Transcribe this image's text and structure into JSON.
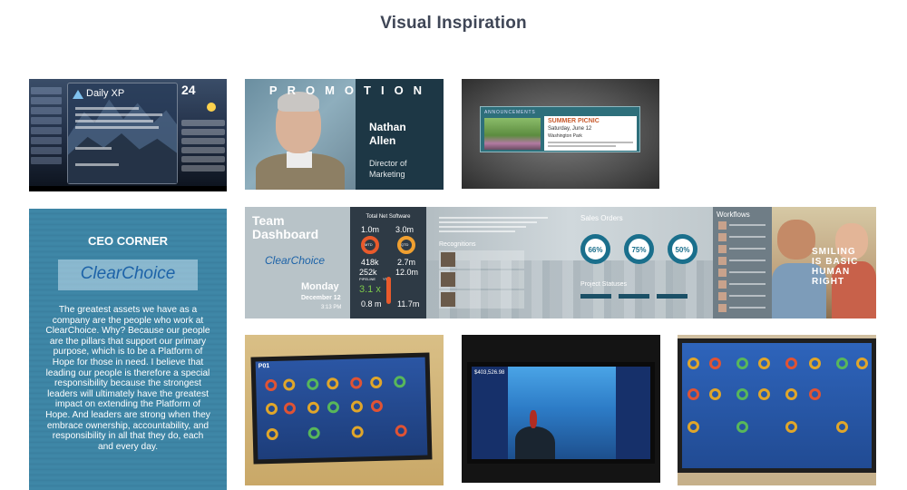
{
  "page": {
    "section_title": "Visual Inspiration"
  },
  "tiles": {
    "daily_xp": {
      "title": "Daily XP",
      "date_number": "24"
    },
    "promotion": {
      "heading": "PROMOTION",
      "first_name": "Nathan",
      "last_name": "Allen",
      "role_line1": "Director of",
      "role_line2": "Marketing"
    },
    "announcements": {
      "label": "ANNOUNCEMENTS",
      "event": "SUMMER PICNIC",
      "date": "Saturday, June 12",
      "location": "Washington Park"
    },
    "ceo_corner": {
      "heading": "CEO CORNER",
      "logo": "ClearChoice",
      "quote": "The greatest assets we have as a company are the people who work at ClearChoice. Why? Because our people are the pillars that support our primary purpose, which is to be a Platform of Hope for those in need. I believe that leading our people is therefore a special responsibility because the strongest leaders will ultimately have the greatest impact on extending the Platform of Hope. And leaders are strong when they embrace ownership, accountability, and responsibility in all that they do, each and every day."
    },
    "team_dashboard": {
      "title_line1": "Team",
      "title_line2": "Dashboard",
      "logo": "ClearChoice",
      "day": "Monday",
      "date": "December 12",
      "time": "3:13 PM",
      "metrics_heading": "Total Net Software",
      "metrics": {
        "v1": "1.0m",
        "v2": "3.0m",
        "mtd": "MTD",
        "qtd": "QTD",
        "v3": "418k",
        "v4": "2.7m",
        "v5": "252k",
        "v6": "12.0m",
        "pipeline": "PIPELINE",
        "ytd": "YTD",
        "v7": "3.1 x",
        "v8": "0.8 m",
        "v9": "11.7m"
      },
      "recognitions": "Recognitions",
      "sales_orders": "Sales Orders",
      "dials": [
        "66%",
        "75%",
        "50%"
      ],
      "project_statuses": "Project Statuses",
      "workflows": "Workflows",
      "photo_caption": "SMILING IS BASIC HUMAN RIGHT"
    },
    "photo_tv_1": {
      "corner_label": "P01"
    },
    "photo_tv_2": {
      "corner_value": "$403,526.98"
    }
  },
  "colors": {
    "title": "#3f4656",
    "promotion_bg": "#1d3745",
    "ceo_bg": "#3c83a3",
    "teal_accent": "#1a6f8c",
    "orange_ring": "#e95a2b",
    "gold_ring": "#f0a030",
    "green_value": "#7cc84a"
  }
}
